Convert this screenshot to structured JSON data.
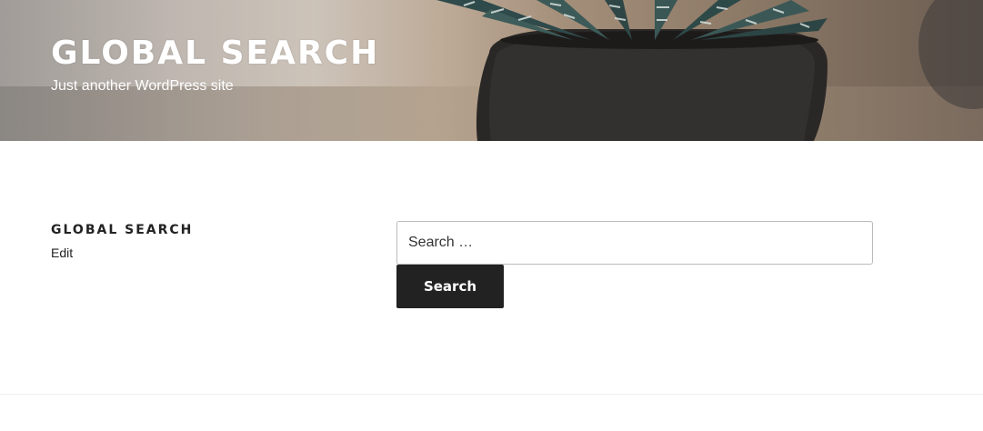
{
  "site": {
    "title": "GLOBAL SEARCH",
    "tagline": "Just another WordPress site"
  },
  "page": {
    "title": "GLOBAL SEARCH",
    "edit_label": "Edit"
  },
  "search": {
    "placeholder": "Search …",
    "button_label": "Search"
  },
  "header_image": {
    "subject": "succulent-plant-in-dark-pot"
  },
  "colors": {
    "button_bg": "#222222",
    "button_text": "#ffffff",
    "header_text": "#ffffff",
    "body_text": "#222222"
  }
}
